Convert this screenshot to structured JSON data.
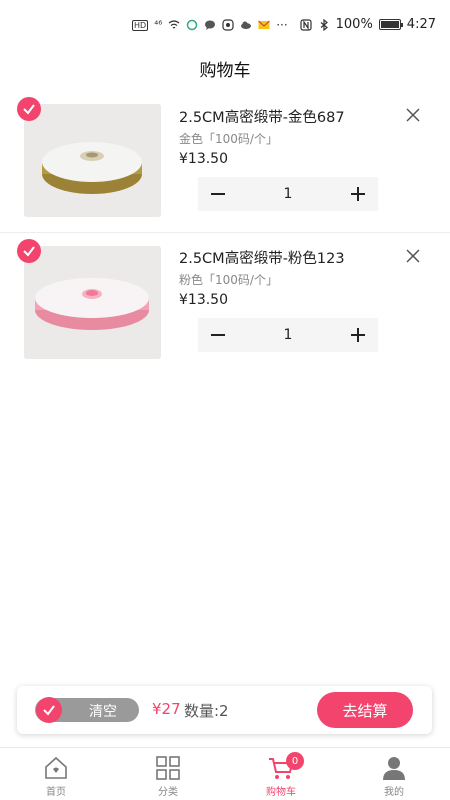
{
  "status_bar": {
    "left_text": "HD",
    "signal_text": "⁴⁶",
    "right_text": "100%",
    "time": "4:27",
    "battery_level": 1.0
  },
  "header": {
    "title": "购物车"
  },
  "cart": {
    "items": [
      {
        "title": "2.5CM高密缎带-金色687",
        "spec": "金色「100码/个」",
        "price": "¥13.50",
        "quantity": "1",
        "selected": true,
        "ribbon_color": "#b49a44"
      },
      {
        "title": "2.5CM高密缎带-粉色123",
        "spec": "粉色「100码/个」",
        "price": "¥13.50",
        "quantity": "1",
        "selected": true,
        "ribbon_color": "#f3a3b4"
      }
    ]
  },
  "action_bar": {
    "clear_label": "清空",
    "total": "¥27",
    "quantity_label": "数量:2",
    "checkout_label": "去结算"
  },
  "tabs": [
    {
      "label": "首页",
      "icon": "home-icon",
      "active": false
    },
    {
      "label": "分类",
      "icon": "grid-icon",
      "active": false
    },
    {
      "label": "购物车",
      "icon": "cart-icon",
      "active": true,
      "badge": "0"
    },
    {
      "label": "我的",
      "icon": "user-icon",
      "active": false
    }
  ],
  "colors": {
    "accent": "#f2446c",
    "stepper_bg": "#f5f5f5",
    "muted_text": "#888888"
  }
}
